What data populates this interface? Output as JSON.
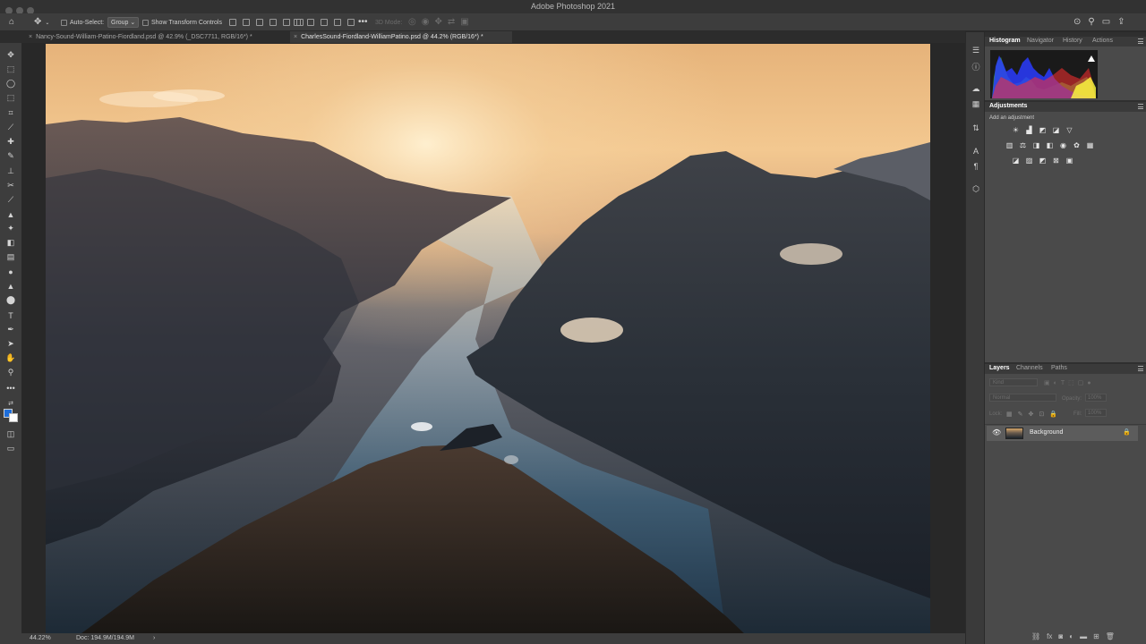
{
  "window": {
    "title": "Adobe Photoshop 2021"
  },
  "options_bar": {
    "auto_select_label": "Auto-Select:",
    "auto_select_value": "Group",
    "transform_controls_label": "Show Transform Controls",
    "mode_label": "3D Mode:"
  },
  "tabs": [
    {
      "label": "Nancy-Sound-William-Patino-Fiordland.psd @ 42.9% (_DSC7711, RGB/16*) *",
      "active": false
    },
    {
      "label": "CharlesSound-Fiordland-WilliamPatino.psd @ 44.2% (RGB/16*) *",
      "active": true
    }
  ],
  "status_bar": {
    "zoom": "44.22%",
    "doc_info": "Doc: 194.9M/194.9M",
    "arrow": "›"
  },
  "panels": {
    "histogram_tabs": [
      "Histogram",
      "Navigator",
      "History",
      "Actions"
    ],
    "adjustments_title": "Adjustments",
    "adjustments_hint": "Add an adjustment",
    "layers_tabs": [
      "Layers",
      "Channels",
      "Paths"
    ],
    "layers_filter_placeholder": "Kind",
    "blend_mode": "Normal",
    "opacity_label": "Opacity:",
    "opacity_value": "100%",
    "lock_label": "Lock:",
    "fill_label": "Fill:",
    "fill_value": "100%",
    "layer_name": "Background"
  },
  "colors": {
    "foreground": "#1d6dd9",
    "background": "#ffffff",
    "histogram_warning": "#ffffff"
  }
}
